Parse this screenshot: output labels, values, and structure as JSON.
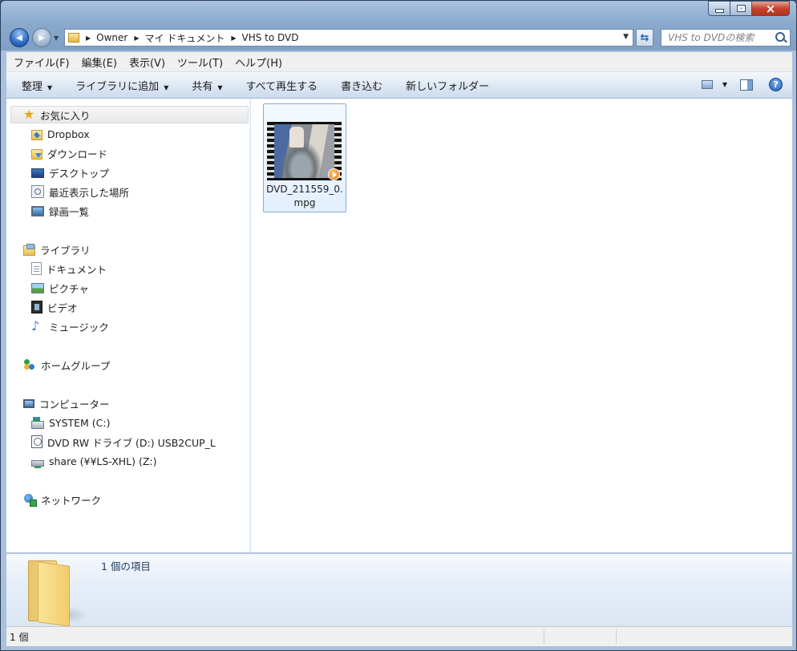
{
  "window": {
    "title_buttons": {
      "minimize": "minimize",
      "maximize": "maximize",
      "close": "×"
    }
  },
  "nav": {
    "back_icon": "◀",
    "forward_icon": "▶",
    "breadcrumb": [
      "Owner",
      "マイ ドキュメント",
      "VHS to DVD"
    ],
    "search_placeholder": "VHS to DVDの検索"
  },
  "menu": [
    "ファイル(F)",
    "編集(E)",
    "表示(V)",
    "ツール(T)",
    "ヘルプ(H)"
  ],
  "commands": {
    "organize": "整理",
    "add_to_library": "ライブラリに追加",
    "share": "共有",
    "play_all": "すべて再生する",
    "burn": "書き込む",
    "new_folder": "新しいフォルダー",
    "help": "?"
  },
  "sidebar": {
    "favorites": {
      "label": "お気に入り",
      "items": [
        "Dropbox",
        "ダウンロード",
        "デスクトップ",
        "最近表示した場所",
        "録画一覧"
      ]
    },
    "libraries": {
      "label": "ライブラリ",
      "items": [
        "ドキュメント",
        "ピクチャ",
        "ビデオ",
        "ミュージック"
      ]
    },
    "homegroup": {
      "label": "ホームグループ"
    },
    "computer": {
      "label": "コンピューター",
      "items": [
        "SYSTEM (C:)",
        "DVD RW ドライブ (D:) USB2CUP_L",
        "share (¥¥LS-XHL) (Z:)"
      ]
    },
    "network": {
      "label": "ネットワーク"
    }
  },
  "files": [
    {
      "name_line1": "DVD_211559_0.",
      "name_line2": "mpg",
      "type_icon": "video-thumbnail-icon"
    }
  ],
  "details": {
    "item_count": "1 個の項目"
  },
  "status": {
    "count": "1 個"
  }
}
